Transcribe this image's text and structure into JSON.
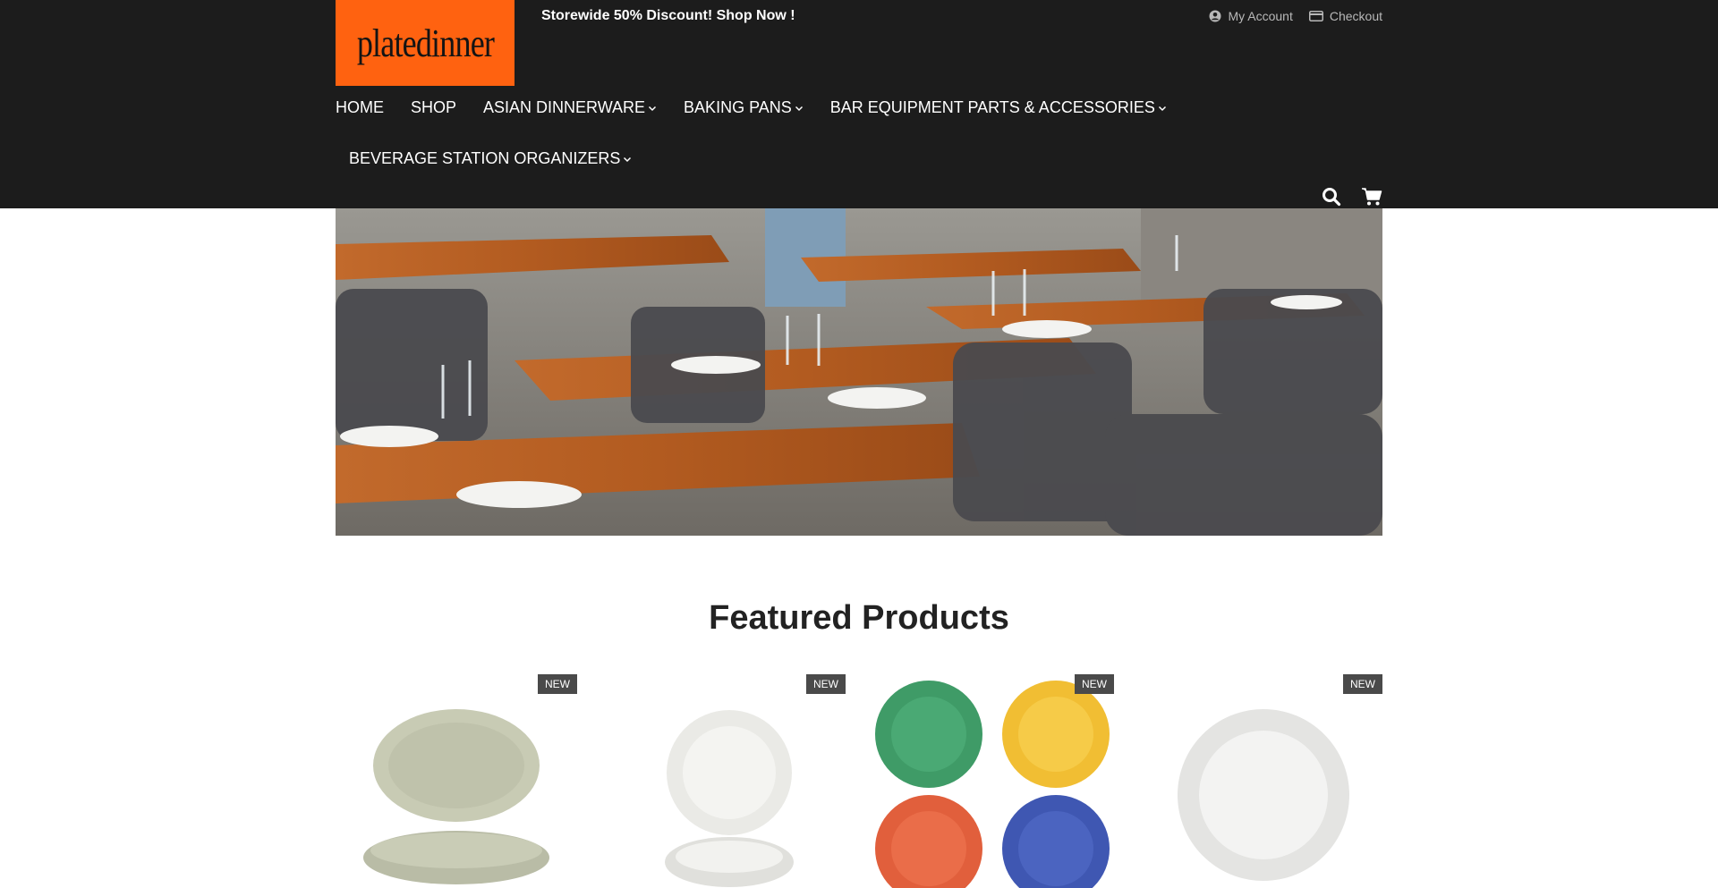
{
  "header": {
    "logo_text": "platedinner",
    "promo": "Storewide 50% Discount! Shop Now !",
    "top_links": [
      {
        "label": "My Account",
        "icon": "user-circle-icon"
      },
      {
        "label": "Checkout",
        "icon": "credit-card-icon"
      }
    ],
    "nav": [
      {
        "label": "HOME",
        "has_dropdown": false
      },
      {
        "label": "SHOP",
        "has_dropdown": false
      },
      {
        "label": "ASIAN DINNERWARE",
        "has_dropdown": true
      },
      {
        "label": "BAKING PANS",
        "has_dropdown": true
      },
      {
        "label": "BAR EQUIPMENT PARTS & ACCESSORIES",
        "has_dropdown": true
      },
      {
        "label": "BEVERAGE STATION ORGANIZERS",
        "has_dropdown": true
      }
    ],
    "icons": [
      "search-icon",
      "cart-icon"
    ]
  },
  "featured": {
    "title": "Featured Products",
    "products": [
      {
        "badge": "NEW"
      },
      {
        "badge": "NEW"
      },
      {
        "badge": "NEW"
      },
      {
        "badge": "NEW"
      }
    ]
  },
  "colors": {
    "header_bg": "#1c1c1c",
    "logo_bg": "#ff6210",
    "badge_bg": "#4a4a4a"
  }
}
